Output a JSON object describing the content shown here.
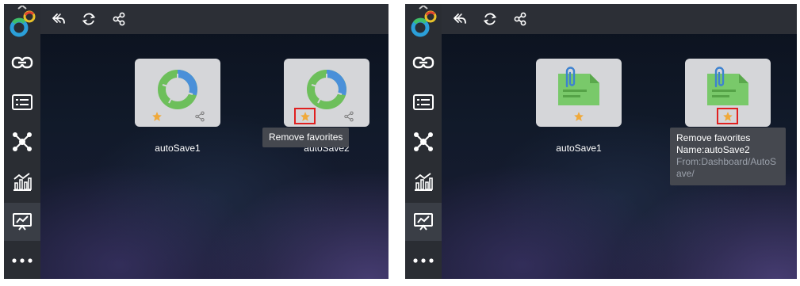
{
  "panels": {
    "left": {
      "cards": [
        {
          "label": "autoSave1",
          "type": "donut-chart"
        },
        {
          "label": "autoSave2",
          "type": "donut-chart"
        }
      ],
      "tooltip": {
        "text": "Remove favorites"
      }
    },
    "right": {
      "cards": [
        {
          "label": "autoSave1",
          "type": "document"
        },
        {
          "label": "autoSave2",
          "type": "document"
        }
      ],
      "tooltip": {
        "line1": "Remove favorites",
        "line2": "Name:autoSave2",
        "line3": "From:Dashboard/AutoS",
        "line4": "ave/"
      }
    }
  },
  "toolbar_icons": [
    "back-icon",
    "refresh-icon",
    "share-icon"
  ],
  "sidebar_icons": [
    "link-icon",
    "list-card-icon",
    "network-icon",
    "bar-chart-icon",
    "presentation-icon",
    "more-icon"
  ],
  "colors": {
    "star": "#f0a93a",
    "highlight": "#e02020",
    "donut_blue": "#4a90d9",
    "donut_green": "#6dbf5b",
    "doc_green": "#79c96a",
    "clip_blue": "#3d82d0"
  }
}
